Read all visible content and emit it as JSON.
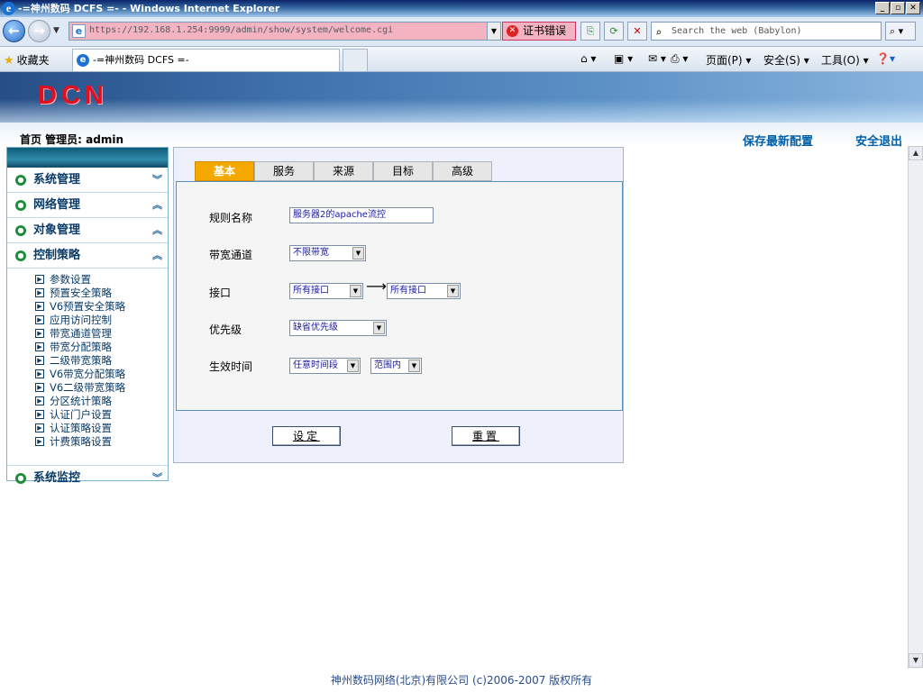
{
  "window": {
    "title": "-=神州数码 DCFS =- - Windows Internet Explorer"
  },
  "browser": {
    "address": "https://192.168.1.254:9999/admin/show/system/welcome.cgi",
    "cert_error": "证书错误",
    "search_placeholder": "Search the web (Babylon)",
    "favorites": "收藏夹",
    "tab_title": "-=神州数码 DCFS =-",
    "tools": {
      "page": "页面(P)",
      "safety": "安全(S)",
      "tools": "工具(O)"
    }
  },
  "header": {
    "logo": "DCN",
    "breadcrumb": "首页 管理员: admin",
    "save_config": "保存最新配置",
    "logout": "安全退出"
  },
  "sidebar": {
    "sections": {
      "system": "系统管理",
      "network": "网络管理",
      "objects": "对象管理",
      "control": "控制策略",
      "monitor": "系统监控"
    },
    "items": [
      "参数设置",
      "预置安全策略",
      "V6预置安全策略",
      "应用访问控制",
      "带宽通道管理",
      "带宽分配策略",
      "二级带宽策略",
      "V6带宽分配策略",
      "V6二级带宽策略",
      "分区统计策略",
      "认证门户设置",
      "认证策略设置",
      "计费策略设置"
    ]
  },
  "form": {
    "tabs": [
      "基本",
      "服务",
      "来源",
      "目标",
      "高级"
    ],
    "labels": {
      "rule_name": "规则名称",
      "channel": "带宽通道",
      "interface": "接口",
      "priority": "优先级",
      "time": "生效时间"
    },
    "values": {
      "rule_name": "服务器2的apache流控",
      "channel": "不限带宽",
      "interface_from": "所有接口",
      "interface_to": "所有接口",
      "priority": "缺省优先级",
      "time_range": "任意时间段",
      "time_scope": "范围内"
    },
    "buttons": {
      "set": "设定",
      "reset": "重置"
    }
  },
  "footer": {
    "copyright": "神州数码网络(北京)有限公司 (c)2006-2007 版权所有"
  }
}
